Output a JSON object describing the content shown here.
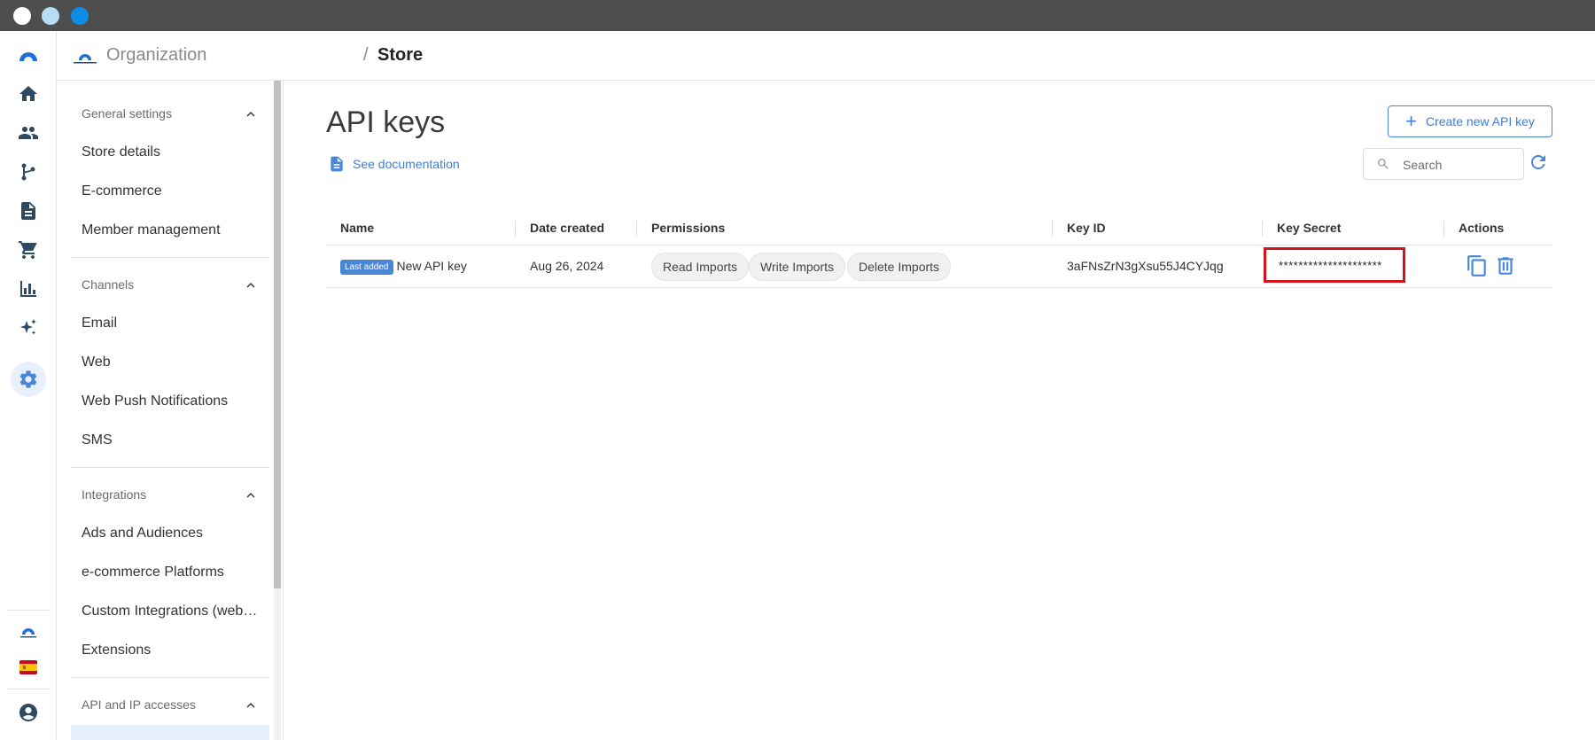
{
  "window": {
    "controls": [
      "close",
      "minimize",
      "maximize"
    ]
  },
  "rail": {
    "items": [
      {
        "icon": "logo-icon"
      },
      {
        "icon": "home-icon"
      },
      {
        "icon": "people-icon"
      },
      {
        "icon": "branch-icon"
      },
      {
        "icon": "document-icon"
      },
      {
        "icon": "cart-icon"
      },
      {
        "icon": "bar-chart-icon"
      },
      {
        "icon": "sparkle-icon"
      },
      {
        "icon": "gear-icon",
        "active": true
      }
    ],
    "bottom": [
      {
        "icon": "org-logo-icon"
      },
      {
        "icon": "spain-flag-icon"
      },
      {
        "icon": "account-icon"
      }
    ]
  },
  "header": {
    "org_name": "Organization",
    "separator": "/",
    "store": "Store"
  },
  "sidebar": {
    "general": {
      "title": "General settings",
      "items": [
        "Store details",
        "E-commerce",
        "Member management"
      ]
    },
    "channels": {
      "title": "Channels",
      "items": [
        "Email",
        "Web",
        "Web Push Notifications",
        "SMS"
      ]
    },
    "integrations": {
      "title": "Integrations",
      "items": [
        "Ads and Audiences",
        "e-commerce Platforms",
        "Custom Integrations (webhooks)",
        "Extensions"
      ]
    },
    "api": {
      "title": "API and IP accesses"
    }
  },
  "main": {
    "title": "API keys",
    "doc_link": "See documentation",
    "create_button": "Create new API key",
    "search_placeholder": "Search",
    "table": {
      "columns": [
        "Name",
        "Date created",
        "Permissions",
        "Key ID",
        "Key Secret",
        "Actions"
      ],
      "rows": [
        {
          "badge": "Last added",
          "name": "New API key",
          "date": "Aug 26, 2024",
          "permissions": [
            "Read Imports",
            "Write Imports",
            "Delete Imports"
          ],
          "key_id": "3aFNsZrN3gXsu55J4CYJqg",
          "key_secret": "*********************"
        }
      ]
    }
  },
  "colors": {
    "accent": "#4a86d8",
    "highlight": "#d4141a",
    "titlebar": "#4e4e4e"
  }
}
